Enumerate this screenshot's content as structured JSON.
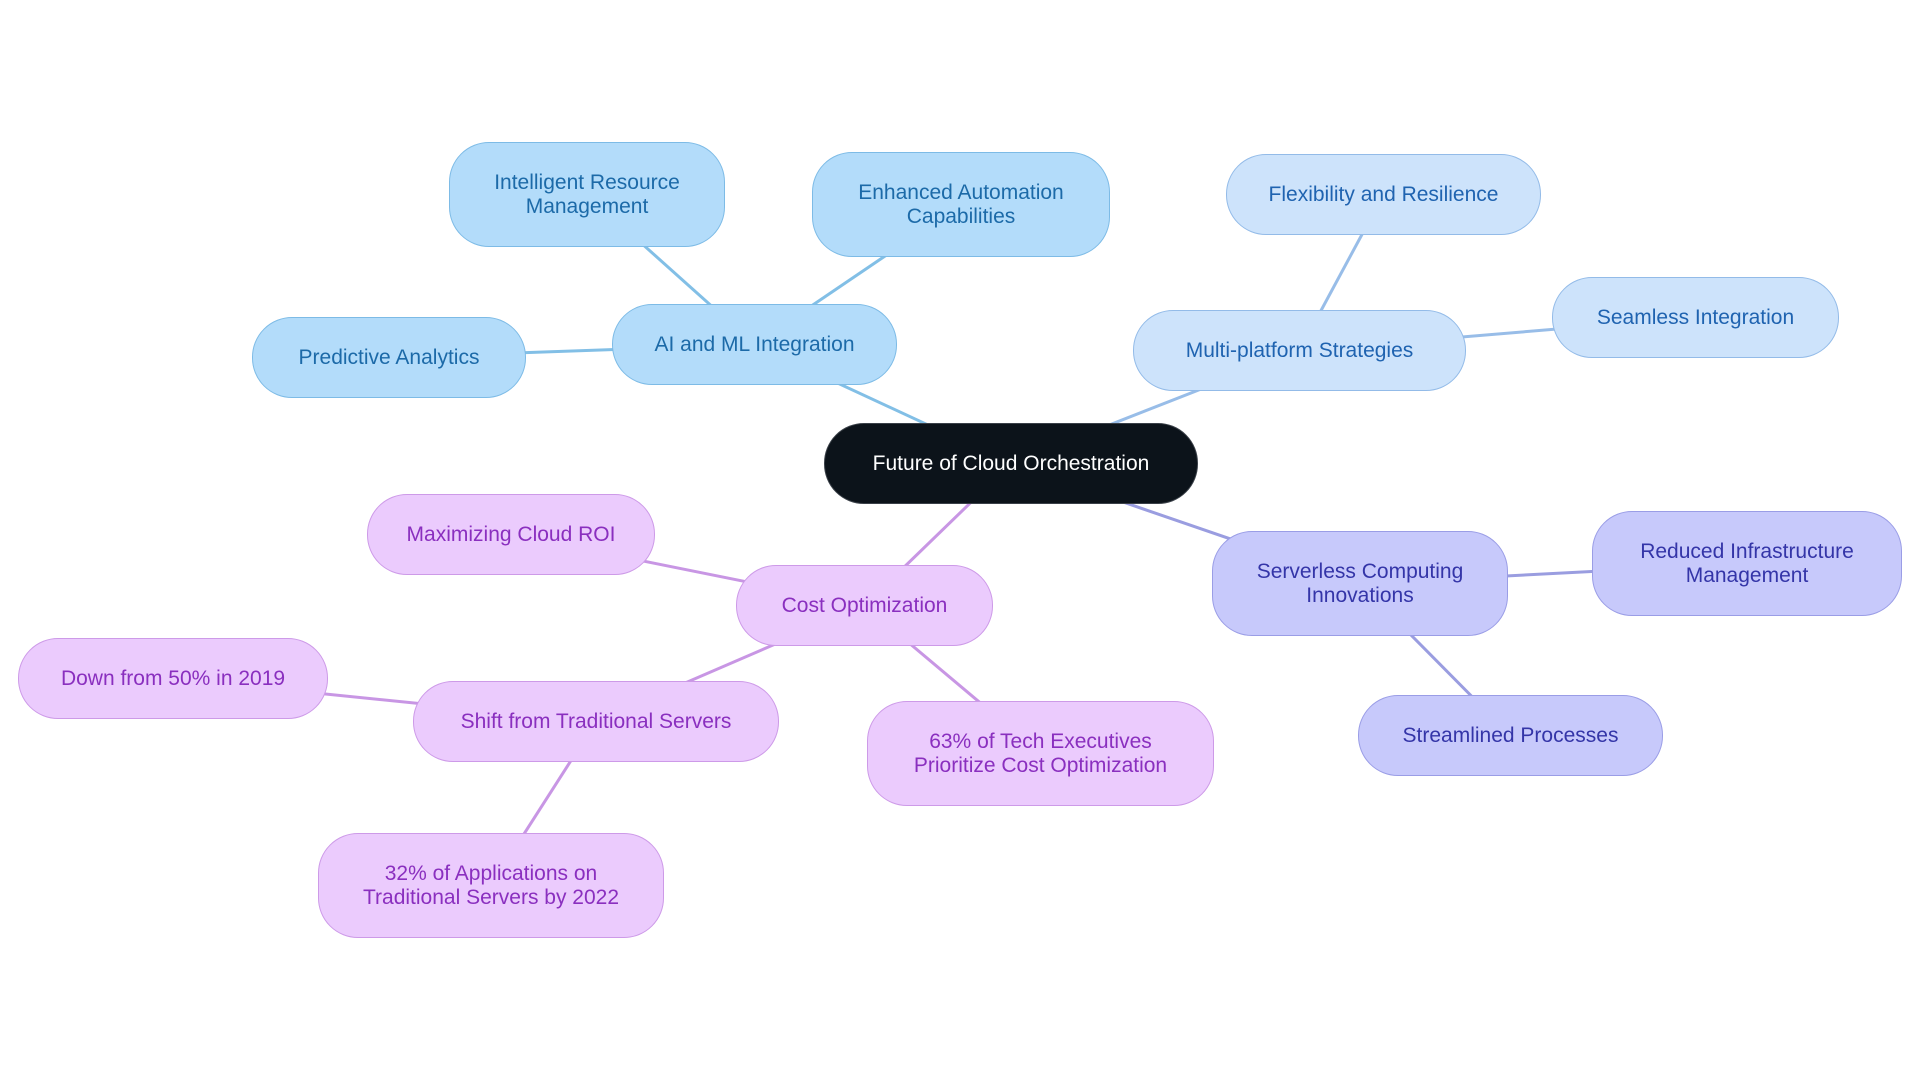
{
  "title": "Future of Cloud Orchestration",
  "colors": {
    "root_fill": "#0c131a",
    "ai_ml_branch": "#b3dcfa",
    "ai_ml_edge": "#82bfe6",
    "multiplatform_branch": "#cde3fb",
    "multiplatform_edge": "#98bde8",
    "serverless_branch": "#c7c9fb",
    "serverless_edge": "#9a9de0",
    "cost_branch": "#ebcbfd",
    "cost_edge": "#c896e4"
  },
  "nodes": {
    "root": "Future of Cloud Orchestration",
    "ai_ml": "AI and ML Integration",
    "intelligent_resource": "Intelligent Resource\nManagement",
    "enhanced_automation": "Enhanced Automation\nCapabilities",
    "predictive_analytics": "Predictive Analytics",
    "multiplatform": "Multi-platform Strategies",
    "flexibility": "Flexibility and Resilience",
    "seamless": "Seamless Integration",
    "serverless": "Serverless Computing\nInnovations",
    "reduced_infra": "Reduced Infrastructure\nManagement",
    "streamlined": "Streamlined Processes",
    "cost": "Cost Optimization",
    "max_roi": "Maximizing Cloud ROI",
    "shift": "Shift from Traditional Servers",
    "down_from": "Down from 50% in 2019",
    "apps_2022": "32% of Applications on\nTraditional Servers by 2022",
    "tech_execs": "63% of Tech Executives\nPrioritize Cost Optimization"
  },
  "edges": [
    [
      "root",
      "ai_ml",
      "ai_ml_edge"
    ],
    [
      "ai_ml",
      "intelligent_resource",
      "ai_ml_edge"
    ],
    [
      "ai_ml",
      "enhanced_automation",
      "ai_ml_edge"
    ],
    [
      "ai_ml",
      "predictive_analytics",
      "ai_ml_edge"
    ],
    [
      "root",
      "multiplatform",
      "multiplatform_edge"
    ],
    [
      "multiplatform",
      "flexibility",
      "multiplatform_edge"
    ],
    [
      "multiplatform",
      "seamless",
      "multiplatform_edge"
    ],
    [
      "root",
      "serverless",
      "serverless_edge"
    ],
    [
      "serverless",
      "reduced_infra",
      "serverless_edge"
    ],
    [
      "serverless",
      "streamlined",
      "serverless_edge"
    ],
    [
      "root",
      "cost",
      "cost_edge"
    ],
    [
      "cost",
      "max_roi",
      "cost_edge"
    ],
    [
      "cost",
      "shift",
      "cost_edge"
    ],
    [
      "cost",
      "tech_execs",
      "cost_edge"
    ],
    [
      "shift",
      "down_from",
      "cost_edge"
    ],
    [
      "shift",
      "apps_2022",
      "cost_edge"
    ]
  ]
}
